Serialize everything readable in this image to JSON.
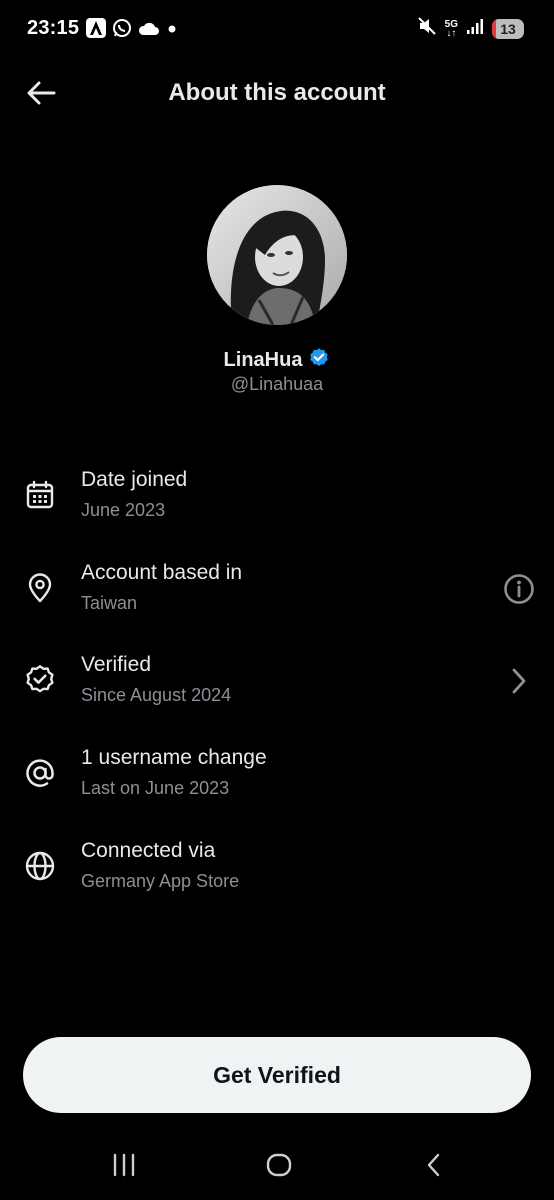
{
  "status_bar": {
    "time": "23:15",
    "network": "5G",
    "battery_level": "13"
  },
  "header": {
    "title": "About this account"
  },
  "profile": {
    "display_name": "LinaHua",
    "handle": "@Linahuaa"
  },
  "info": {
    "date_joined": {
      "title": "Date joined",
      "value": "June 2023",
      "icon": "calendar-icon"
    },
    "based_in": {
      "title": "Account based in",
      "value": "Taiwan",
      "icon": "location-pin-icon"
    },
    "verified": {
      "title": "Verified",
      "value": "Since August 2024",
      "icon": "verified-badge-icon"
    },
    "username": {
      "title": "1 username change",
      "value": "Last on June 2023",
      "icon": "at-sign-icon"
    },
    "connected": {
      "title": "Connected via",
      "value": "Germany App Store",
      "icon": "globe-icon"
    }
  },
  "cta": {
    "label": "Get Verified"
  },
  "colors": {
    "background": "#000000",
    "primary_text": "#e7e9ea",
    "secondary_text": "#8b9096",
    "verified_blue": "#1d9bf0",
    "cta_background": "#eff3f4"
  }
}
